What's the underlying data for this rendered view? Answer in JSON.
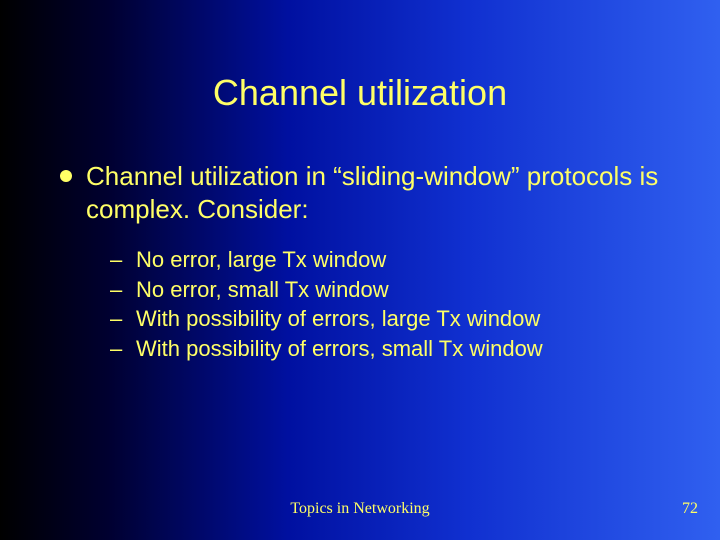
{
  "title": "Channel utilization",
  "bullets": [
    {
      "text": "Channel utilization in “sliding-window” protocols is complex. Consider:",
      "sub": [
        "No error, large Tx window",
        "No error, small Tx window",
        "With possibility of errors, large Tx window",
        "With possibility of errors, small Tx window"
      ]
    }
  ],
  "footer": "Topics in Networking",
  "page_number": "72",
  "dash": "–"
}
